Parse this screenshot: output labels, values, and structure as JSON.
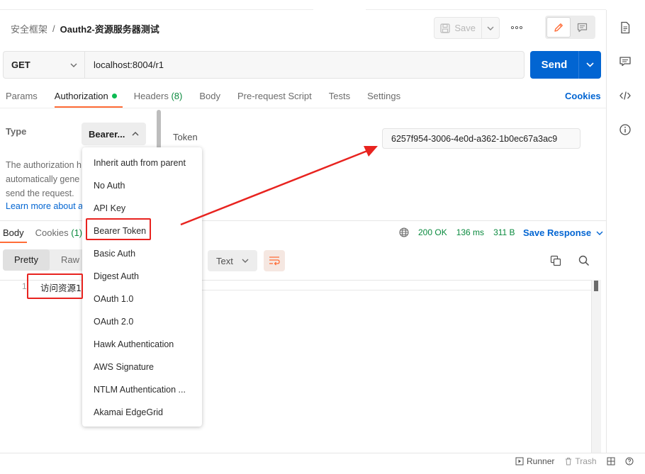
{
  "header": {
    "breadcrumb_parent": "安全框架",
    "breadcrumb_separator": "/",
    "request_name": "Oauth2-资源服务器测试",
    "save_label": "Save",
    "more_label": "ooo"
  },
  "request": {
    "method": "GET",
    "url": "localhost:8004/r1",
    "send_label": "Send"
  },
  "request_tabs": [
    {
      "label": "Params",
      "count": "",
      "active": false
    },
    {
      "label": "Authorization",
      "count": "",
      "active": true
    },
    {
      "label": "Headers",
      "count": "(8)",
      "active": false
    },
    {
      "label": "Body",
      "count": "",
      "active": false
    },
    {
      "label": "Pre-request Script",
      "count": "",
      "active": false
    },
    {
      "label": "Tests",
      "count": "",
      "active": false
    },
    {
      "label": "Settings",
      "count": "",
      "active": false
    }
  ],
  "cookies_label": "Cookies",
  "auth": {
    "type_label": "Type",
    "type_value": "Bearer...",
    "description_lines": [
      "The authorization h",
      "automatically gene",
      "send the request."
    ],
    "learn_more": "Learn more about a",
    "token_label": "Token",
    "token_value": "6257f954-3006-4e0d-a362-1b0ec67a3ac9"
  },
  "auth_menu": {
    "items": [
      "Inherit auth from parent",
      "No Auth",
      "API Key",
      "Bearer Token",
      "Basic Auth",
      "Digest Auth",
      "OAuth 1.0",
      "OAuth 2.0",
      "Hawk Authentication",
      "AWS Signature",
      "NTLM Authentication ...",
      "Akamai EdgeGrid"
    ],
    "highlighted": "Bearer Token"
  },
  "response": {
    "tabs": [
      {
        "label": "Body",
        "count": ""
      },
      {
        "label": "Cookies",
        "count": "(1)"
      }
    ],
    "status": "200 OK",
    "time": "136 ms",
    "size": "311 B",
    "save_response_label": "Save Response",
    "format_tabs": [
      "Pretty",
      "Raw"
    ],
    "content_type": "Text",
    "line_number": "1",
    "body_text": "访问资源1"
  },
  "footer": {
    "runner_label": "Runner",
    "trash_label": "Trash"
  },
  "colors": {
    "send_blue": "#0265d2",
    "tab_accent": "#ff6c37",
    "status_green": "#0a8a3e",
    "annotation_red": "#e8231f"
  }
}
